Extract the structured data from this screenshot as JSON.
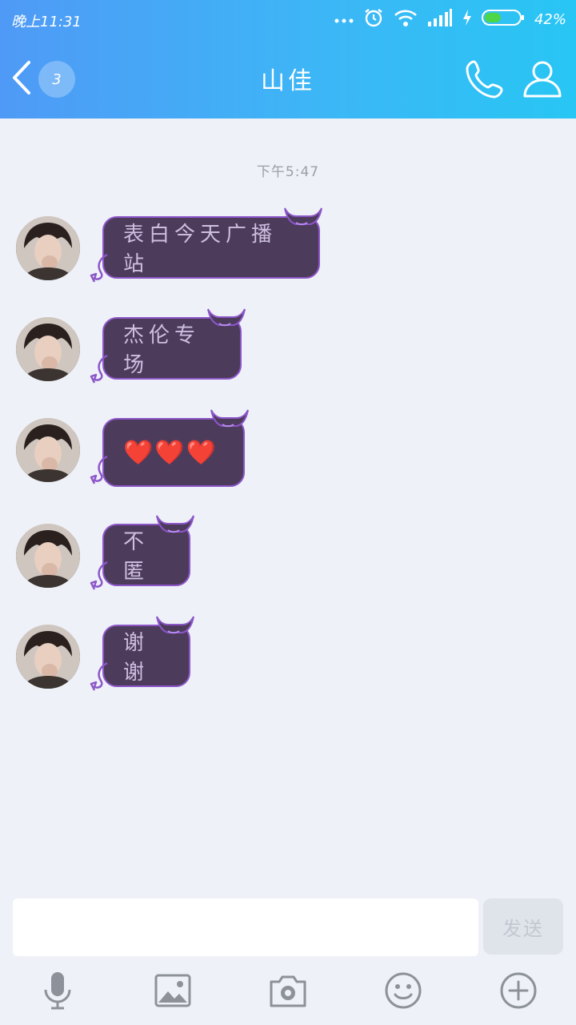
{
  "status_bar": {
    "time": "晚上11:31",
    "battery": "42%"
  },
  "header": {
    "unread_count": "3",
    "title": "山佳"
  },
  "chat": {
    "timestamp": "下午5:47",
    "messages": [
      {
        "text": "表白今天广播站"
      },
      {
        "text": "杰伦专场"
      },
      {
        "text": "❤️❤️❤️"
      },
      {
        "text": "不匿"
      },
      {
        "text": "谢谢"
      }
    ]
  },
  "composer": {
    "placeholder": "",
    "send_label": "发送"
  },
  "toolbar": {
    "icons": [
      "microphone-icon",
      "image-icon",
      "camera-icon",
      "emoji-icon",
      "plus-icon"
    ]
  },
  "colors": {
    "header_start": "#4f9af6",
    "header_end": "#28c6f4",
    "bubble_bg": "#4d3b5b",
    "bubble_border": "#8c56c9",
    "bubble_text": "#cdbfe0",
    "chat_bg": "#eef1f7"
  }
}
